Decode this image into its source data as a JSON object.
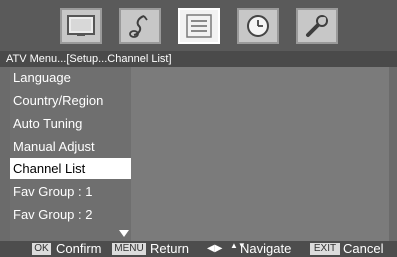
{
  "breadcrumb": "ATV Menu...[Setup...Channel List]",
  "tabs": [
    {
      "icon": "picture-icon"
    },
    {
      "icon": "sound-note-icon"
    },
    {
      "icon": "channel-list-icon"
    },
    {
      "icon": "clock-icon"
    },
    {
      "icon": "wrench-icon"
    }
  ],
  "menu": {
    "items": [
      {
        "label": "Language"
      },
      {
        "label": "Country/Region"
      },
      {
        "label": "Auto Tuning"
      },
      {
        "label": "Manual Adjust"
      },
      {
        "label": "Channel List",
        "selected": true
      },
      {
        "label": "Fav Group : 1"
      },
      {
        "label": "Fav Group : 2"
      }
    ]
  },
  "footer": {
    "ok_key": "OK",
    "ok_label": "Confirm",
    "menu_key": "MENU",
    "menu_label": "Return",
    "navigate_glyph": "◀▶",
    "navigate_glyph_2": "▲▼",
    "navigate_label": "Navigate",
    "exit_key": "EXIT",
    "exit_label": "Cancel"
  },
  "colors": {
    "osd_background": "#6b6b6b",
    "selected_item_background": "#ffffff",
    "text": "#ffffff"
  }
}
